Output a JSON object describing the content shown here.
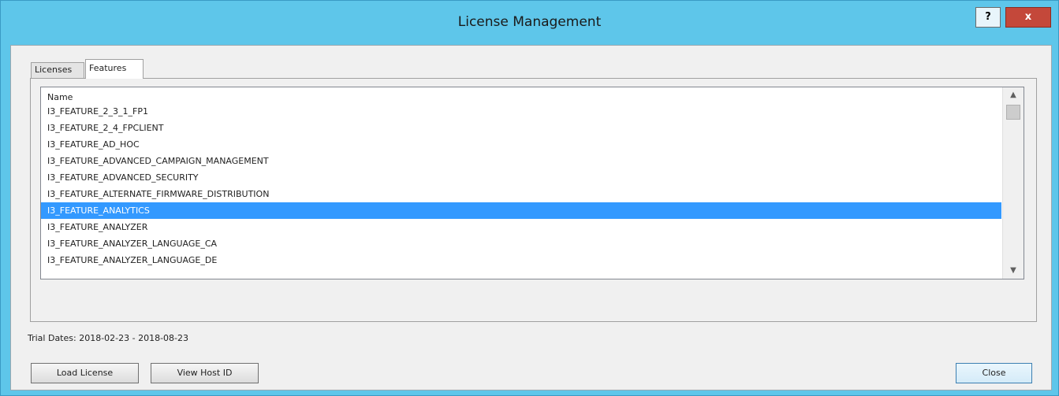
{
  "window": {
    "title": "License Management",
    "help_label": "?",
    "close_label": "x"
  },
  "tabs": [
    {
      "label": "Licenses",
      "active": false
    },
    {
      "label": "Features",
      "active": true
    }
  ],
  "features_list": {
    "column_header": "Name",
    "items": [
      "I3_FEATURE_2_3_1_FP1",
      "I3_FEATURE_2_4_FPCLIENT",
      "I3_FEATURE_AD_HOC",
      "I3_FEATURE_ADVANCED_CAMPAIGN_MANAGEMENT",
      "I3_FEATURE_ADVANCED_SECURITY",
      "I3_FEATURE_ALTERNATE_FIRMWARE_DISTRIBUTION",
      "I3_FEATURE_ANALYTICS",
      "I3_FEATURE_ANALYZER",
      "I3_FEATURE_ANALYZER_LANGUAGE_CA",
      "I3_FEATURE_ANALYZER_LANGUAGE_DE"
    ],
    "selected_index": 6,
    "scroll_up_icon": "chevron-up-icon",
    "scroll_down_icon": "chevron-down-icon"
  },
  "trial": {
    "text": "Trial Dates: 2018-02-23 - 2018-08-23"
  },
  "buttons": {
    "load_license": "Load License",
    "view_host_id": "View Host ID",
    "close": "Close"
  }
}
